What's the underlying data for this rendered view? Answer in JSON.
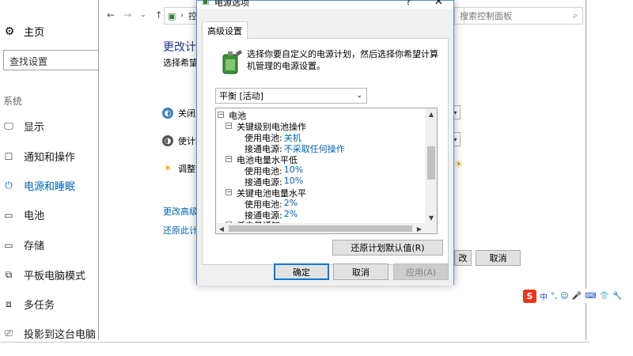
{
  "settings": {
    "home_label": "主页",
    "search_placeholder": "查找设置",
    "section_label": "系统",
    "nav": [
      {
        "label": "显示",
        "icon": "monitor-icon",
        "glyph": "🖵"
      },
      {
        "label": "通知和操作",
        "icon": "notification-icon",
        "glyph": "☐"
      },
      {
        "label": "电源和睡眠",
        "icon": "power-icon",
        "glyph": "⏻",
        "active": true
      },
      {
        "label": "电池",
        "icon": "battery-icon",
        "glyph": "▭"
      },
      {
        "label": "存储",
        "icon": "storage-icon",
        "glyph": "▭"
      },
      {
        "label": "平板电脑模式",
        "icon": "tablet-mode-icon",
        "glyph": "⧉"
      },
      {
        "label": "多任务",
        "icon": "multitask-icon",
        "glyph": "⧈"
      },
      {
        "label": "投影到这台电脑",
        "icon": "project-icon",
        "glyph": "⎚"
      }
    ]
  },
  "control_panel": {
    "address_text": "控",
    "search_placeholder": "搜索控制面板",
    "title_partial": "更改计划",
    "subtitle_partial": "选择希望计",
    "row1_partial": "关闭显",
    "row2_partial": "使计算",
    "row3_partial": "调整计",
    "link1_partial": "更改高级电",
    "link2_partial": "还原此计划",
    "save_partial": "改",
    "cancel_label": "取消"
  },
  "dialog": {
    "title": "电源选项",
    "help": "?",
    "close": "✕",
    "tab_label": "高级设置",
    "description": "选择你要自定义的电源计划，然后选择你希望计算机管理的电源设置。",
    "plan_selected": "平衡 [活动]",
    "tree": {
      "battery": "电池",
      "critical_action": "关键级别电池操作",
      "on_battery_label": "使用电池:",
      "plugged_in_label": "接通电源:",
      "critical_on_battery": "关机",
      "critical_plugged": "不采取任何操作",
      "low_level": "电池电量水平低",
      "low_on_battery": "10%",
      "low_plugged": "10%",
      "critical_level": "关键电池电量水平",
      "crit_level_on_battery": "2%",
      "crit_level_plugged": "2%",
      "low_notify_partial": "低电量通知"
    },
    "restore_defaults": "还原计划默认值(R)",
    "ok": "确定",
    "cancel": "取消",
    "apply": "应用(A)"
  },
  "ime": {
    "logo": "S",
    "lang": "中"
  },
  "colors": {
    "accent": "#0063b1",
    "link": "#0063b1",
    "title_blue": "#1e3287"
  }
}
